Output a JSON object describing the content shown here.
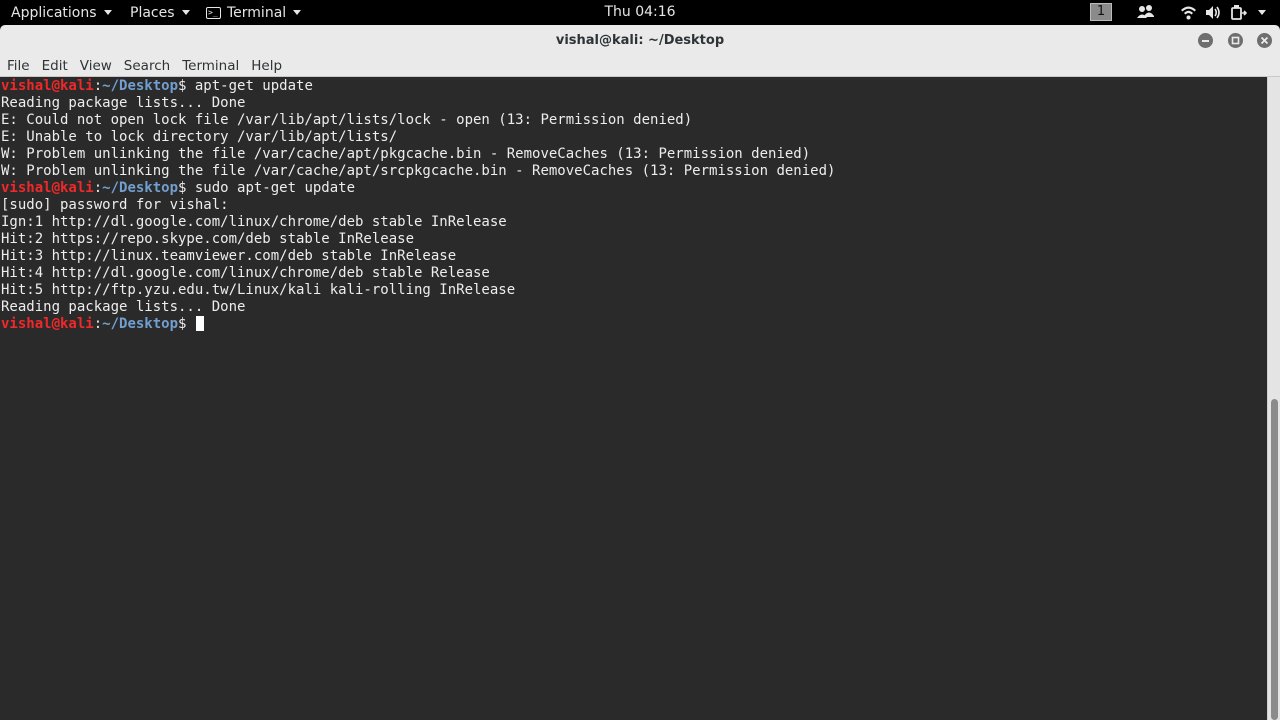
{
  "topbar": {
    "applications_label": "Applications",
    "places_label": "Places",
    "terminal_label": "Terminal",
    "clock": "Thu 04:16",
    "workspace": "1"
  },
  "window": {
    "title": "vishal@kali: ~/Desktop"
  },
  "menu": [
    "File",
    "Edit",
    "View",
    "Search",
    "Terminal",
    "Help"
  ],
  "prompt": {
    "user": "vishal@kali",
    "sep": ":",
    "path": "~/Desktop",
    "symbol": "$ "
  },
  "terminal": {
    "lines": [
      {
        "prompt": true,
        "text": "apt-get update"
      },
      {
        "text": "Reading package lists... Done"
      },
      {
        "text": "E: Could not open lock file /var/lib/apt/lists/lock - open (13: Permission denied)"
      },
      {
        "text": "E: Unable to lock directory /var/lib/apt/lists/"
      },
      {
        "text": "W: Problem unlinking the file /var/cache/apt/pkgcache.bin - RemoveCaches (13: Permission denied)"
      },
      {
        "text": "W: Problem unlinking the file /var/cache/apt/srcpkgcache.bin - RemoveCaches (13: Permission denied)"
      },
      {
        "prompt": true,
        "text": "sudo apt-get update"
      },
      {
        "text": "[sudo] password for vishal:"
      },
      {
        "text": "Ign:1 http://dl.google.com/linux/chrome/deb stable InRelease"
      },
      {
        "text": "Hit:2 https://repo.skype.com/deb stable InRelease"
      },
      {
        "text": "Hit:3 http://linux.teamviewer.com/deb stable InRelease"
      },
      {
        "text": "Hit:4 http://dl.google.com/linux/chrome/deb stable Release"
      },
      {
        "text": "Hit:5 http://ftp.yzu.edu.tw/Linux/kali kali-rolling InRelease"
      },
      {
        "text": "Reading package lists... Done"
      },
      {
        "prompt": true,
        "text": "",
        "cursor": true
      }
    ]
  },
  "colors": {
    "prompt_user": "#ef2929",
    "prompt_path": "#729fcf",
    "terminal_bg": "#2a2a2a",
    "terminal_fg": "#ededed"
  },
  "icons": {
    "terminal_app": "terminal-icon",
    "chat": "people-icon",
    "wifi": "wifi-icon",
    "volume": "volume-icon",
    "power": "power-icon",
    "minimize": "minimize-icon",
    "maximize": "maximize-icon",
    "close": "close-icon"
  }
}
